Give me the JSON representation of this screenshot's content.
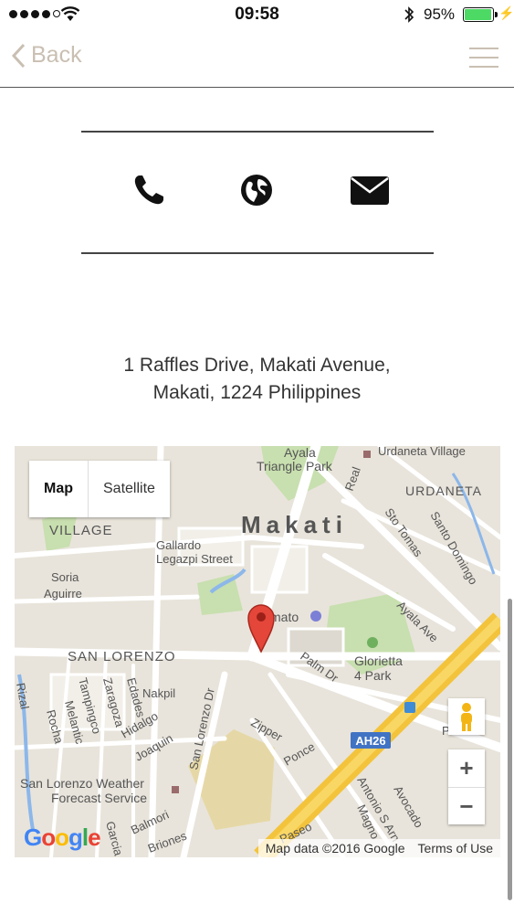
{
  "status": {
    "time": "09:58",
    "battery": "95%",
    "signal_bars": 5,
    "signal_filled": 4,
    "battery_level": 0.95
  },
  "nav": {
    "back_label": "Back"
  },
  "contact": {
    "icons": [
      "phone-icon",
      "globe-icon",
      "envelope-icon"
    ]
  },
  "address": {
    "line1": "1 Raffles Drive, Makati Avenue,",
    "line2": "Makati, 1224 Philippines"
  },
  "map": {
    "type_options": [
      "Map",
      "Satellite"
    ],
    "selected_type": "Map",
    "labels": {
      "makati": "Makati",
      "ayala_triangle": "Ayala",
      "ayala_triangle2": "Triangle Park",
      "urdaneta_village": "Urdaneta Village",
      "urdaneta": "URDANETA",
      "village": "VILLAGE",
      "gallardo": "Gallardo",
      "legazpi": "Legazpi Street",
      "soria": "Soria",
      "aguirre": "Aguirre",
      "san_lorenzo": "SAN LORENZO",
      "nakpil": "Nakpil",
      "tampingco": "Tampingco",
      "zaragoza": "Zaragoza",
      "edades": "Edades",
      "hidalgo": "Hidalgo",
      "melantic": "Melantic",
      "rocha": "Rocha",
      "joaquin": "Joaquin",
      "san_lorenzo_dr": "San Lorenzo Dr",
      "zipper": "Zipper",
      "ponce": "Ponce",
      "palm_dr": "Palm Dr",
      "glorietta": "Glorietta",
      "glorietta2": "4 Park",
      "ayala_ave": "Ayala Ave",
      "sto_tomas": "Sto Tomas",
      "santo_domingo": "Santo Domingo",
      "real": "Real",
      "ah26": "AH26",
      "paseo": "Paseo",
      "antonio": "Antonio S Arn",
      "avocado": "Avocado",
      "magno": "Magno",
      "balmori": "Balmori",
      "garcia": "Garcia",
      "rones": "Briones",
      "pasay": "Pasai",
      "ama": "mato",
      "weather1": "San Lorenzo Weather",
      "weather2": "Forecast Service",
      "rizal": "Rizal"
    },
    "zoom_in": "+",
    "zoom_out": "−",
    "attribution": "Map data ©2016 Google",
    "terms": "Terms of Use",
    "logo": "Google"
  }
}
